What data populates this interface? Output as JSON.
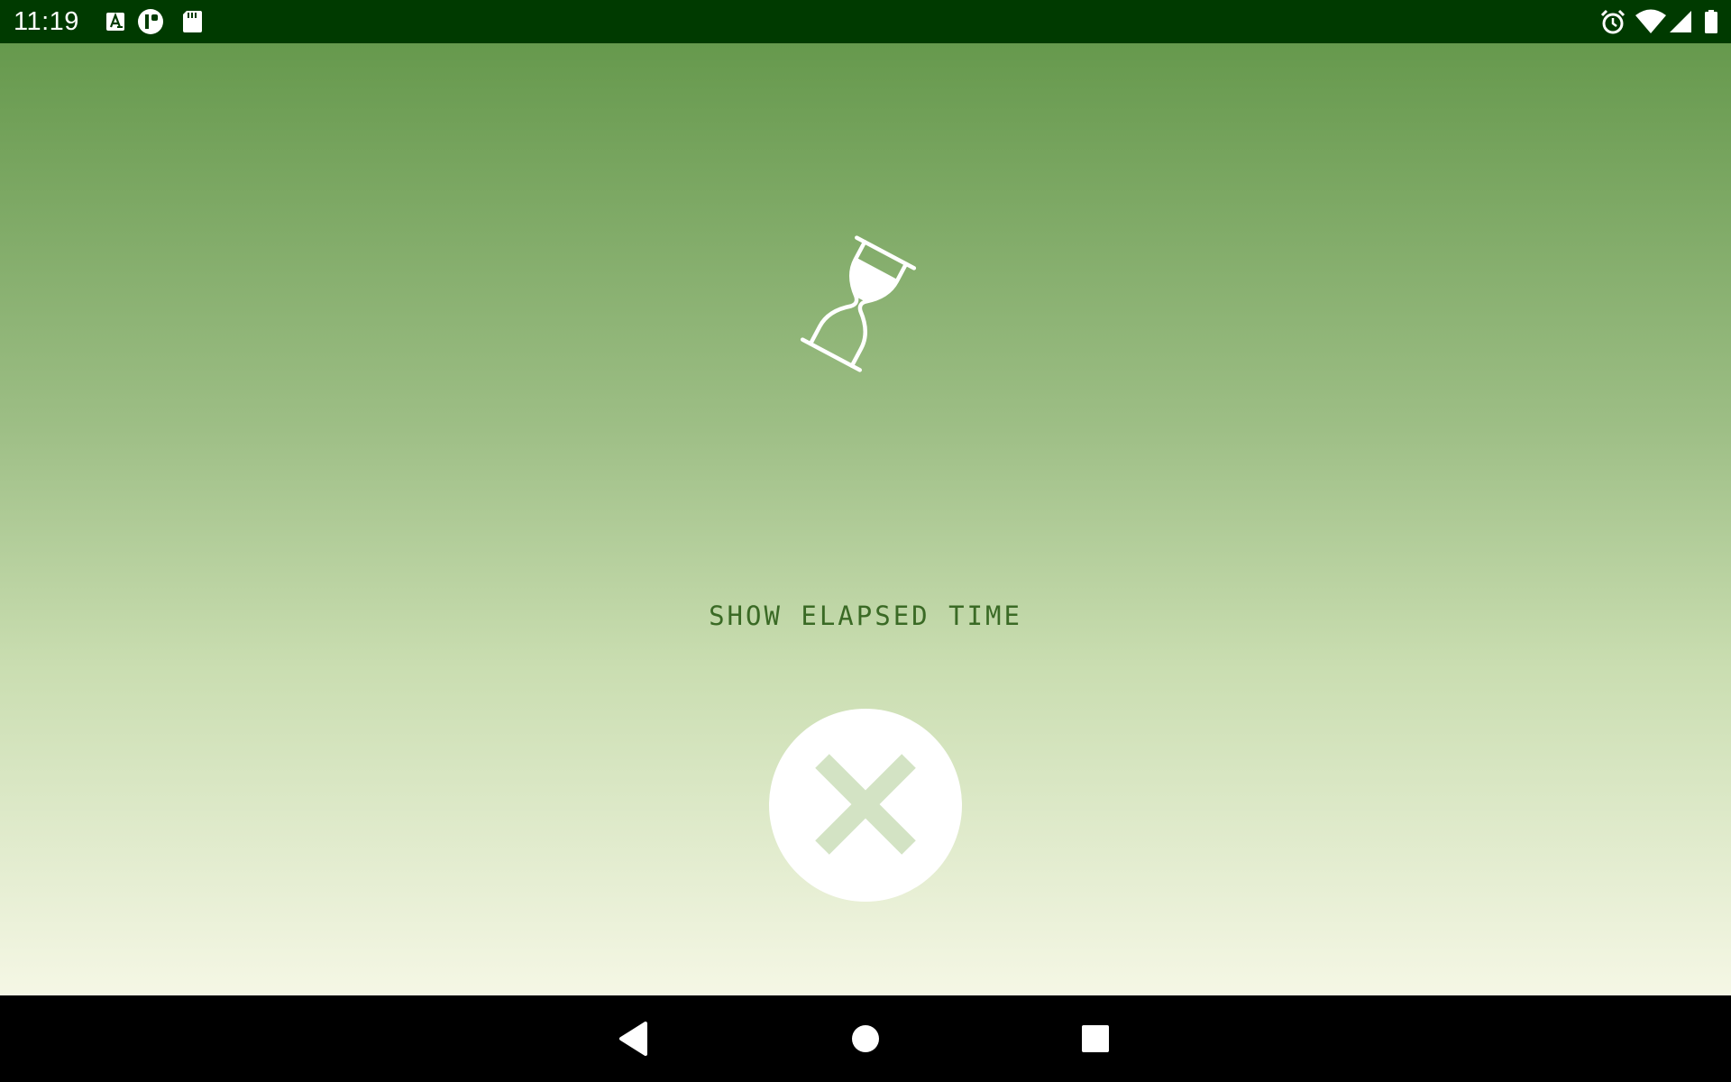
{
  "status_bar": {
    "time": "11:19",
    "notification_icons": [
      "font-download-icon",
      "app-notification-icon",
      "sd-card-icon"
    ],
    "system_icons": [
      "alarm-icon",
      "wifi-icon",
      "cell-signal-icon",
      "battery-icon"
    ]
  },
  "main": {
    "icon": "hourglass-icon",
    "label": "SHOW ELAPSED TIME",
    "close_button": {
      "icon": "close-icon"
    }
  },
  "nav_bar": {
    "buttons": [
      "back-icon",
      "home-icon",
      "recents-icon"
    ]
  },
  "colors": {
    "status_bar": "#003a00",
    "gradient_top": "#66994d",
    "gradient_bottom": "#f5f7e5",
    "label_text": "#3a6a25",
    "close_x": "#d3e3c4",
    "nav_bar": "#000000"
  }
}
